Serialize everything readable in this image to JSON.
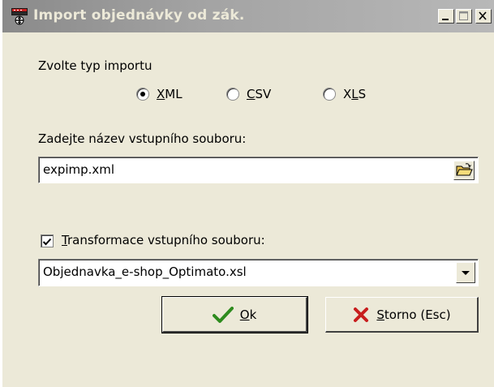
{
  "window": {
    "title": "Import objednávky od zák."
  },
  "import_type": {
    "label": "Zvolte typ importu",
    "options": [
      {
        "label_pre": "",
        "label_u": "X",
        "label_post": "ML",
        "checked": true
      },
      {
        "label_pre": "",
        "label_u": "C",
        "label_post": "SV",
        "checked": false
      },
      {
        "label_pre": "X",
        "label_u": "L",
        "label_post": "S",
        "checked": false
      }
    ]
  },
  "input_file": {
    "label": "Zadejte název vstupního souboru:",
    "value": "expimp.xml",
    "browse_icon": "folder-open-icon"
  },
  "transform": {
    "checked": true,
    "label_u": "T",
    "label_rest": "ransformace vstupního souboru:",
    "value": "Objednavka_e-shop_Optimato.xsl"
  },
  "buttons": {
    "ok_u": "O",
    "ok_rest": "k",
    "cancel_u": "S",
    "cancel_rest": "torno (Esc)"
  },
  "colors": {
    "ok_check": "#2e8b1e",
    "cancel_x": "#c81e1e"
  }
}
